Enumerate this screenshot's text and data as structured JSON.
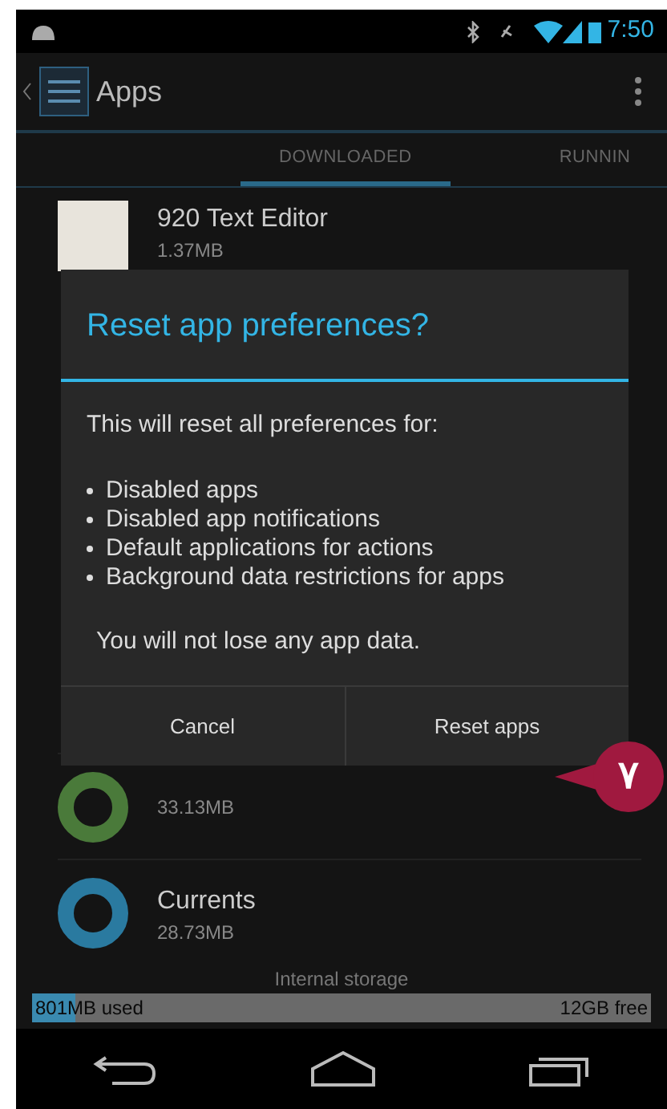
{
  "status_bar": {
    "time": "7:50"
  },
  "action_bar": {
    "title": "Apps"
  },
  "tabs": [
    {
      "label": "DOWNLOADED",
      "selected": true
    },
    {
      "label": "RUNNIN",
      "selected": false
    }
  ],
  "apps": [
    {
      "name": "920 Text Editor",
      "size": "1.37MB",
      "color": "#e8e4dc"
    },
    {
      "size": "33.13MB",
      "color": "#4a7a3a"
    },
    {
      "name": "Currents",
      "size": "28.73MB",
      "color": "#2a7aa0"
    }
  ],
  "storage": {
    "label": "Internal storage",
    "used": "801MB used",
    "free": "12GB free",
    "level": 0.07
  },
  "dialog": {
    "title": "Reset app preferences?",
    "intro": "This will reset all preferences for:",
    "bullets": [
      "Disabled apps",
      "Disabled app notifications",
      "Default applications for actions",
      "Background data restrictions for apps"
    ],
    "footer": "You will not lose any app data.",
    "buttons": [
      "Cancel",
      "Reset apps"
    ]
  },
  "callout": {
    "label": "٧"
  }
}
